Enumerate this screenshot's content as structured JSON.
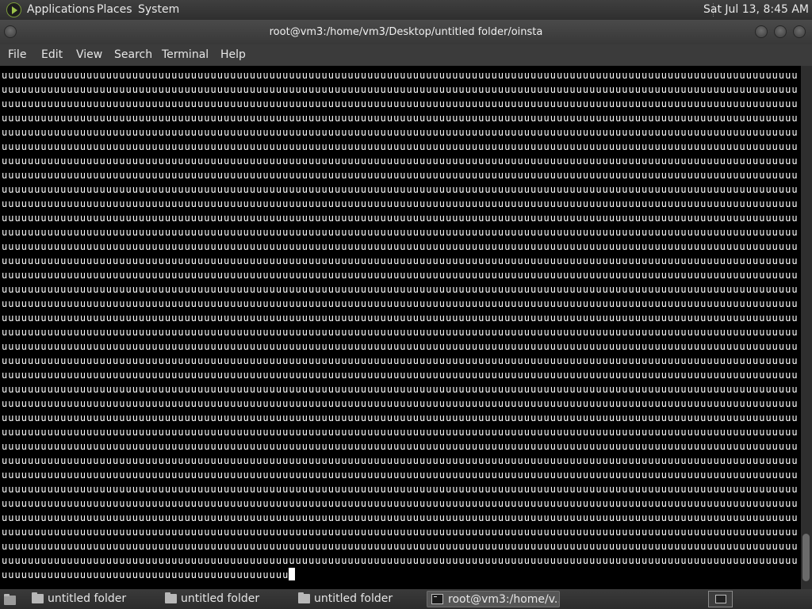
{
  "top_panel": {
    "menus": [
      "Applications",
      "Places",
      "System"
    ],
    "clock": "Sat Jul 13,  8:45 AM"
  },
  "window": {
    "title": "root@vm3:/home/vm3/Desktop/untitled folder/oinsta",
    "menu": [
      "File",
      "Edit",
      "View",
      "Search",
      "Terminal",
      "Help"
    ]
  },
  "terminal": {
    "full_line": "uuuuuuuuuuuuuuuuuuuuuuuuuuuuuuuuuuuuuuuuuuuuuuuuuuuuuuuuuuuuuuuuuuuuuuuuuuuuuuuuuuuuuuuuuuuuuuuuuuuuuuuuuuuuuuuuuuuuuuuuuu",
    "full_line_count": 35,
    "last_line": "uuuuuuuuuuuuuuuuuuuuuuuuuuuuuuuuuuuuuuuuuuuu"
  },
  "taskbar": {
    "tasks": [
      {
        "label": "untitled folder",
        "icon": "folder-icon",
        "active": false
      },
      {
        "label": "untitled folder",
        "icon": "folder-icon",
        "active": false
      },
      {
        "label": "untitled folder",
        "icon": "folder-icon",
        "active": false
      },
      {
        "label": "root@vm3:/home/v...",
        "icon": "terminal-icon",
        "active": true
      }
    ]
  }
}
